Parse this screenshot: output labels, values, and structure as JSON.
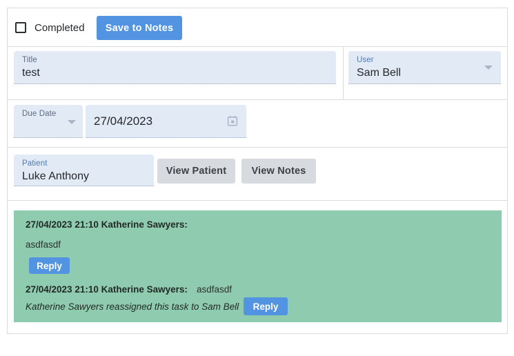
{
  "header": {
    "completed_label": "Completed",
    "completed_checked": false,
    "save_label": "Save to Notes"
  },
  "fields": {
    "title": {
      "label": "Title",
      "value": "test"
    },
    "user": {
      "label": "User",
      "value": "Sam Bell",
      "icon": "chevron-down-icon"
    },
    "due_date_select": {
      "label": "Due Date",
      "value": "",
      "icon": "chevron-down-icon"
    },
    "due_date_value": {
      "label": "",
      "value": "27/04/2023",
      "icon": "calendar-icon"
    },
    "patient": {
      "label": "Patient",
      "value": "Luke Anthony"
    }
  },
  "actions": {
    "view_patient": "View Patient",
    "view_notes": "View Notes"
  },
  "comments": [
    {
      "meta": "27/04/2023 21:10 Katherine Sawyers:",
      "text": "asdfasdf",
      "reply_label": "Reply",
      "layout": "stacked"
    },
    {
      "meta": "27/04/2023 21:10 Katherine Sawyers:",
      "text": "asdfasdf",
      "system": "Katherine Sawyers reassigned this task to Sam Bell",
      "reply_label": "Reply",
      "layout": "inline"
    }
  ],
  "colors": {
    "accent_blue": "#5294e2",
    "field_bg": "#e2eaf6",
    "grey_button": "#d7dadf",
    "comment_green": "#8fcbae",
    "border": "#d8dbdf"
  }
}
